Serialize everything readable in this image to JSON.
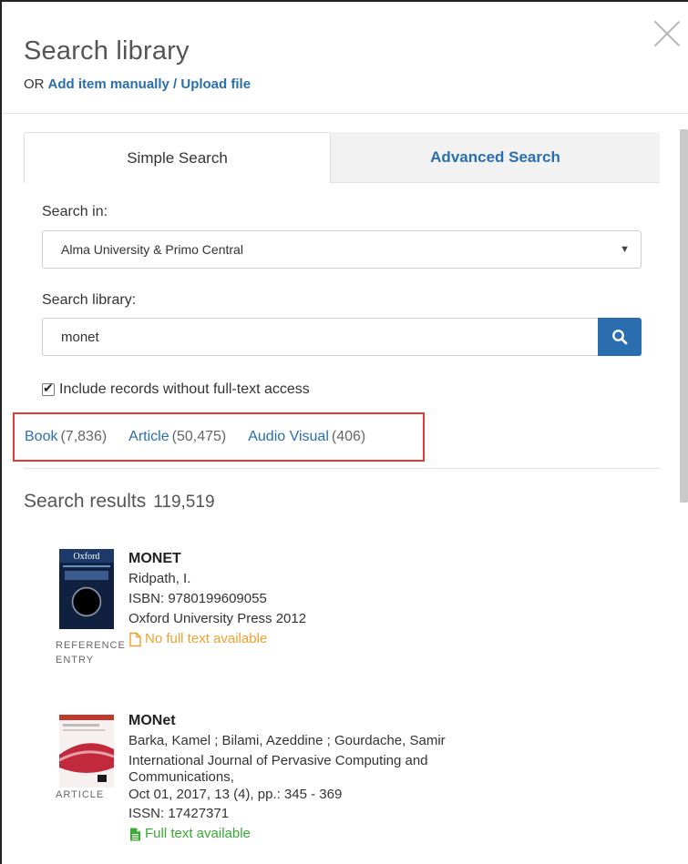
{
  "header": {
    "title": "Search library",
    "or_text": "OR",
    "add_link": "Add item manually / Upload file"
  },
  "tabs": {
    "simple": "Simple Search",
    "advanced": "Advanced Search"
  },
  "form": {
    "search_in_label": "Search in:",
    "search_in_value": "Alma University & Primo Central",
    "search_library_label": "Search library:",
    "query": "monet",
    "include_label": "Include records without full-text access",
    "include_checked": true
  },
  "facets": [
    {
      "name": "Book",
      "count": "(7,836)"
    },
    {
      "name": "Article",
      "count": "(50,475)"
    },
    {
      "name": "Audio Visual",
      "count": "(406)"
    }
  ],
  "results": {
    "label": "Search results",
    "count": "119,519",
    "items": [
      {
        "title": "MONET",
        "lines": [
          "Ridpath, I.",
          "ISBN: 9780199609055",
          "Oxford University Press 2012"
        ],
        "availability": "No full text available",
        "type_line1": "REFERENCE",
        "type_line2": "ENTRY",
        "thumb_text": "Oxford"
      },
      {
        "title": "MONet",
        "lines": [
          "Barka, Kamel ; Bilami, Azeddine ; Gourdache, Samir",
          "International Journal of Pervasive Computing and",
          "Communications,",
          "Oct 01, 2017,  13 (4),  pp.: 345 - 369",
          "ISSN: 17427371"
        ],
        "availability": "Full text available",
        "type_line1": "ARTICLE",
        "type_line2": ""
      }
    ]
  },
  "colors": {
    "link": "#2a6eb0",
    "highlight_box": "#e03c3c",
    "no_full_text": "#f0a030",
    "full_text": "#3aaa35"
  }
}
